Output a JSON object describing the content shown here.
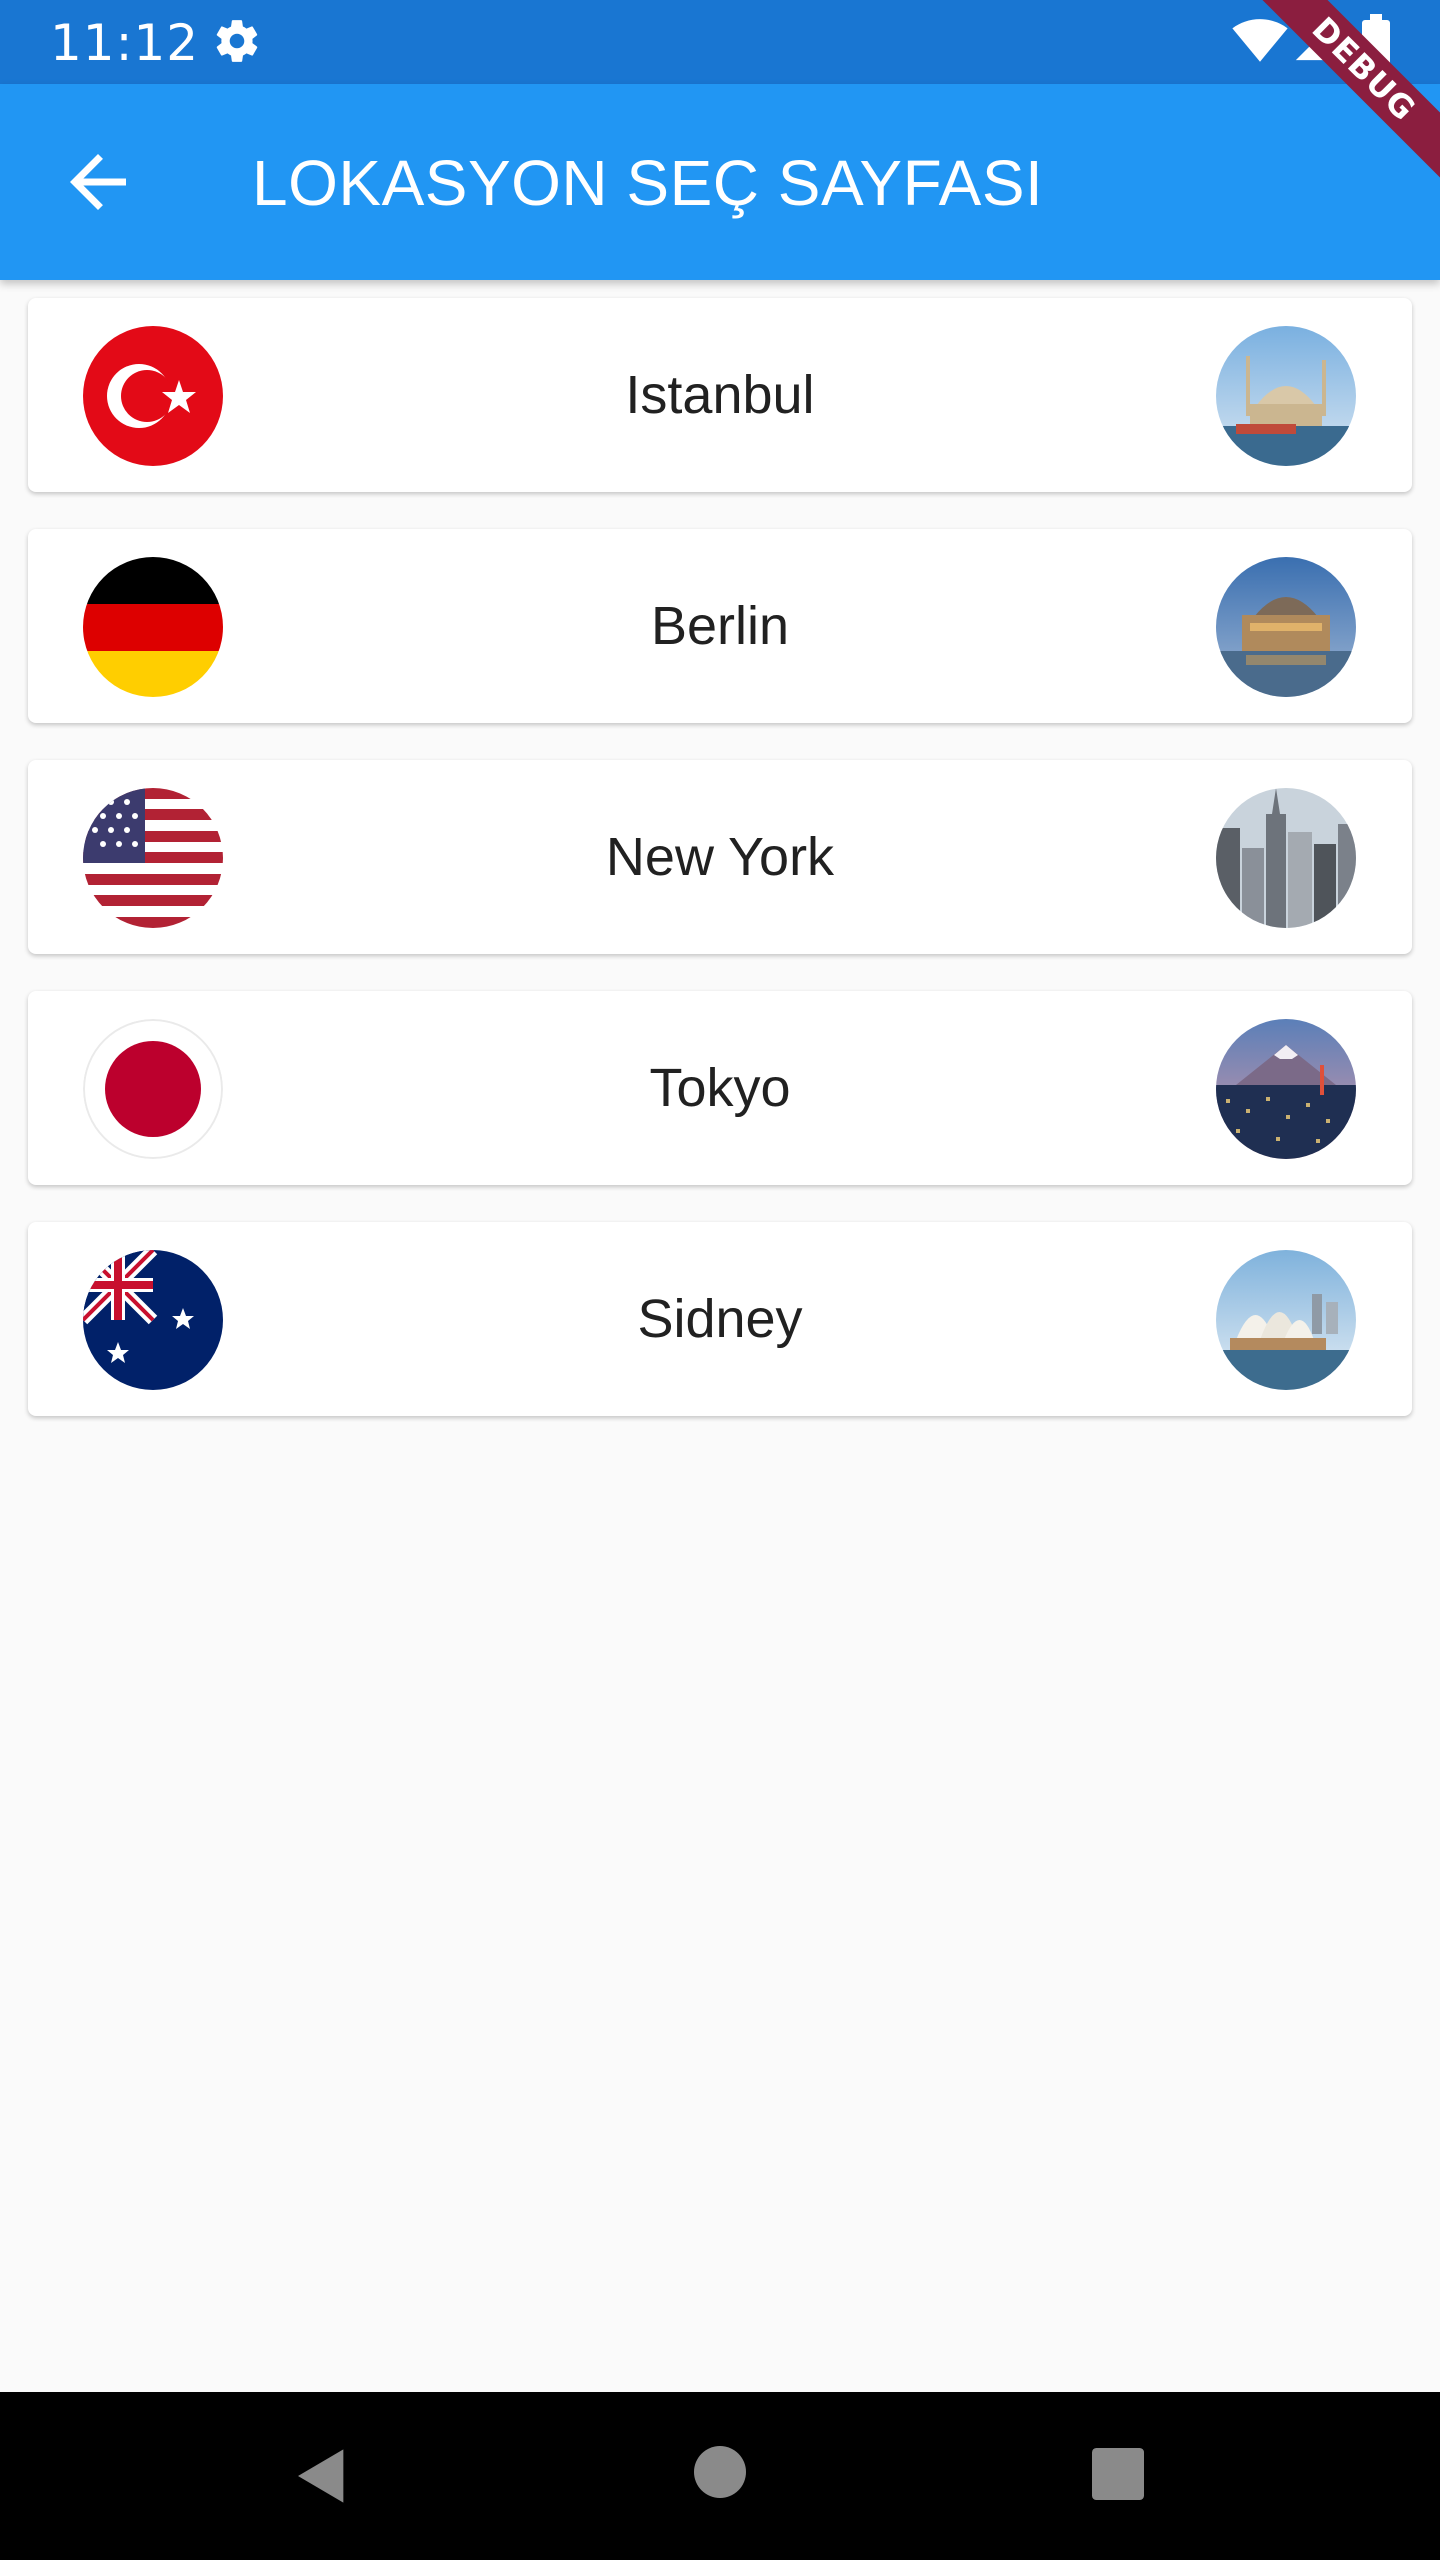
{
  "status_bar": {
    "time": "11:12",
    "icons": [
      "settings-gear-icon",
      "wifi-icon",
      "signal-icon",
      "battery-icon"
    ]
  },
  "app_bar": {
    "title": "LOKASYON SEÇ SAYFASI",
    "back_icon": "arrow-back-icon",
    "color": "#2196f3"
  },
  "debug_banner": "DEBUG",
  "locations": [
    {
      "city": "Istanbul",
      "flag": "turkey-flag-icon"
    },
    {
      "city": "Berlin",
      "flag": "germany-flag-icon"
    },
    {
      "city": "New York",
      "flag": "usa-flag-icon"
    },
    {
      "city": "Tokyo",
      "flag": "japan-flag-icon"
    },
    {
      "city": "Sidney",
      "flag": "australia-flag-icon"
    }
  ],
  "nav_bar": {
    "icons": [
      "nav-back-icon",
      "nav-home-icon",
      "nav-recents-icon"
    ]
  }
}
